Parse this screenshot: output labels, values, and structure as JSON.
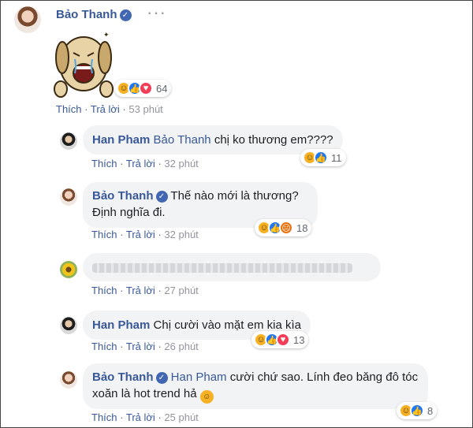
{
  "post": {
    "author": "Bảo Thanh",
    "more_icon": "more-dots-icon",
    "sticker": "crying-dog-sticker",
    "reaction_count": "64",
    "like_label": "Thích",
    "reply_label": "Trả lời",
    "time": "53 phút"
  },
  "comments": [
    {
      "author": "Han Pham",
      "tag": "Bảo Thanh",
      "text": "chị ko thương em????",
      "reaction_count": "11",
      "time": "32 phút"
    },
    {
      "author": "Bảo Thanh",
      "tag": "",
      "text_line1": "Thế nào mới là thương?",
      "text_line2": "Định nghĩa đi.",
      "reaction_count": "18",
      "time": "32 phút"
    },
    {
      "author": "",
      "text": "",
      "time": "27 phút"
    },
    {
      "author": "Han Pham",
      "text": "Chị cười vào mặt em kia kìa",
      "reaction_count": "13",
      "time": "26 phút"
    },
    {
      "author": "Bảo Thanh",
      "tag": "Han Pham",
      "text_line1": "cười chứ sao. Lính đeo băng đô tóc",
      "text_line2": "xoăn là hot trend hả",
      "reaction_count": "8",
      "time": "25 phút"
    }
  ],
  "labels": {
    "like": "Thích",
    "reply": "Trả lời",
    "dot": "·"
  },
  "colors": {
    "link": "#385898",
    "bubble": "#f2f3f5",
    "verified": "#4267b2"
  }
}
